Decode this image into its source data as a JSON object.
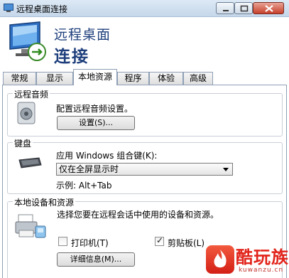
{
  "window": {
    "title": "远程桌面连接",
    "buttons": {
      "minimize": "minimize",
      "maximize": "maximize",
      "close": "close"
    }
  },
  "banner": {
    "line1": "远程桌面",
    "line2": "连接"
  },
  "tabs": [
    {
      "label": "常规",
      "active": false
    },
    {
      "label": "显示",
      "active": false
    },
    {
      "label": "本地资源",
      "active": true
    },
    {
      "label": "程序",
      "active": false
    },
    {
      "label": "体验",
      "active": false
    },
    {
      "label": "高级",
      "active": false
    }
  ],
  "audio": {
    "title": "远程音频",
    "description": "配置远程音频设置。",
    "settings_button": "设置(S)..."
  },
  "keyboard": {
    "title": "键盘",
    "label": "应用 Windows 组合键(K):",
    "selected_option": "仅在全屏显示时",
    "example": "示例: Alt+Tab"
  },
  "devices": {
    "title": "本地设备和资源",
    "description": "选择您要在远程会话中使用的设备和资源。",
    "printer": {
      "label": "打印机(T)",
      "checked": false
    },
    "clipboard": {
      "label": "剪贴板(L)",
      "checked": true
    },
    "details_button": "详细信息(M)..."
  },
  "watermark": {
    "brand": "酷玩族",
    "domain": "kuwanzu.cn",
    "glyph": "酷"
  },
  "colors": {
    "title_blue": "#1e3f7c",
    "brand_red": "#e2231a"
  }
}
